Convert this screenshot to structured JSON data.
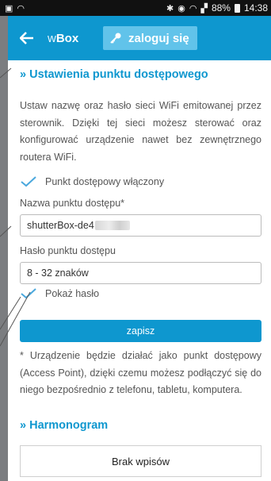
{
  "status_bar": {
    "icons_left": [
      "image-icon",
      "wifi-icon"
    ],
    "icons_right": [
      "bluetooth-icon",
      "alarm-icon",
      "wifi-icon",
      "signal-icon"
    ],
    "battery": "88%",
    "time": "14:38"
  },
  "app_bar": {
    "brand_prefix": "w",
    "brand_name": "Box",
    "login_label": "zaloguj się",
    "color": "#0e97cf"
  },
  "access_point": {
    "title": "» Ustawienia punktu dostępowego",
    "description": "Ustaw nazwę oraz hasło sieci WiFi emitowanej przez sterownik. Dzięki tej sieci możesz sterować oraz konfigurować urządzenie nawet bez zewnętrznego routera WiFi.",
    "enabled_label": "Punkt dostępowy włączony",
    "name_label": "Nazwa punktu dostępu*",
    "name_value": "shutterBox-de4",
    "password_label": "Hasło punktu dostępu",
    "password_value": "8 - 32 znaków",
    "show_password_label": "Pokaż hasło",
    "save_label": "zapisz",
    "note": "* Urządzenie będzie działać jako punkt dostępowy (Access Point), dzięki czemu możesz podłączyć się do niego bezpośrednio z telefonu, tabletu, komputera."
  },
  "schedule": {
    "title": "» Harmonogram",
    "empty_label": "Brak wpisów"
  }
}
